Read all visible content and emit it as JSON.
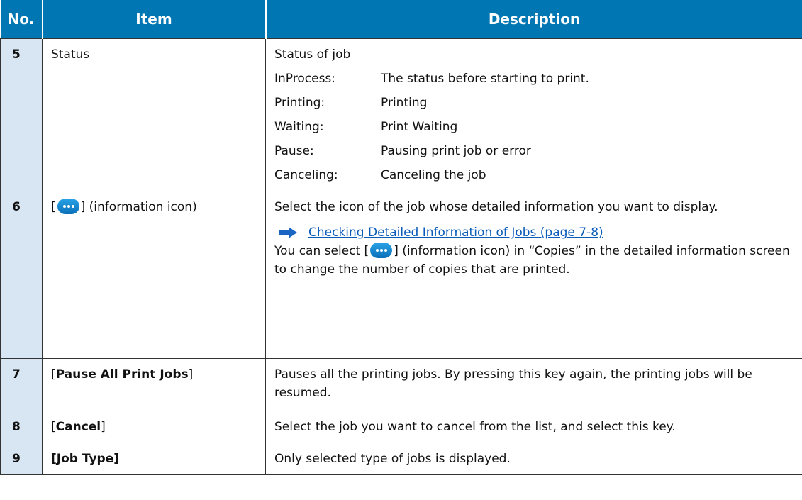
{
  "header": {
    "no": "No.",
    "item": "Item",
    "description": "Description"
  },
  "rows": [
    {
      "no": "5",
      "item": "Status",
      "desc": "Status of job",
      "statuses": [
        {
          "key": "InProcess:",
          "value": "The status before starting to print."
        },
        {
          "key": "Printing:",
          "value": "Printing"
        },
        {
          "key": "Waiting:",
          "value": "Print Waiting"
        },
        {
          "key": "Pause:",
          "value": "Pausing print job or error"
        },
        {
          "key": "Canceling:",
          "value": "Canceling the job"
        }
      ]
    },
    {
      "no": "6",
      "item_pre": "[",
      "item_post": "] (information icon)",
      "desc": "Select the icon of the job whose detailed information you want to display.",
      "link": "Checking Detailed Information of Jobs (page 7-8)",
      "desc2_pre": "You can select [",
      "desc2_post": "] (information icon) in “Copies” in the detailed information screen to change the number of copies that are printed."
    },
    {
      "no": "7",
      "item_pre": "[",
      "item_bold": "Pause All Print Jobs",
      "item_post": "]",
      "desc": "Pauses all the printing jobs. By pressing this key again, the printing jobs will be resumed."
    },
    {
      "no": "8",
      "item_pre": "[",
      "item_bold": "Cancel",
      "item_post": "]",
      "desc": "Select the job you want to cancel from the list, and select this key."
    },
    {
      "no": "9",
      "item": "[Job Type]",
      "desc": "Only selected type of jobs is displayed."
    }
  ],
  "colors": {
    "header_bg": "#0077b3",
    "no_col_bg": "#d8e6f4",
    "link": "#0a5cb8"
  },
  "icons": [
    "information-icon",
    "arrow-right-icon"
  ]
}
